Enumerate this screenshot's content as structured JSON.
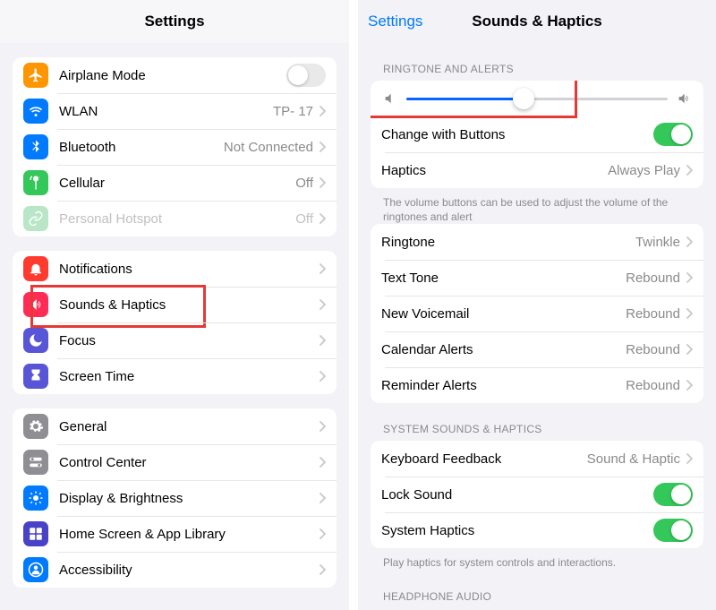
{
  "left": {
    "title": "Settings",
    "groups": [
      {
        "items": [
          {
            "id": "airplane",
            "label": "Airplane Mode",
            "icon": "airplane",
            "color": "#ff9500",
            "control": "toggle",
            "on": false
          },
          {
            "id": "wlan",
            "label": "WLAN",
            "icon": "wifi",
            "color": "#007aff",
            "value": "TP- 17",
            "arrow": true
          },
          {
            "id": "bluetooth",
            "label": "Bluetooth",
            "icon": "bluetooth",
            "color": "#007aff",
            "value": "Not Connected",
            "arrow": true
          },
          {
            "id": "cellular",
            "label": "Cellular",
            "icon": "antenna",
            "color": "#34c759",
            "value": "Off",
            "arrow": true
          },
          {
            "id": "hotspot",
            "label": "Personal Hotspot",
            "icon": "link",
            "color": "#34c759",
            "value": "Off",
            "arrow": true,
            "dimmed": true
          }
        ]
      },
      {
        "items": [
          {
            "id": "notifications",
            "label": "Notifications",
            "icon": "bell",
            "color": "#ff3b30",
            "arrow": true
          },
          {
            "id": "sounds",
            "label": "Sounds & Haptics",
            "icon": "speaker",
            "color": "#ff2d55",
            "arrow": true,
            "highlight": true
          },
          {
            "id": "focus",
            "label": "Focus",
            "icon": "moon",
            "color": "#5856d6",
            "arrow": true
          },
          {
            "id": "screentime",
            "label": "Screen Time",
            "icon": "hourglass",
            "color": "#5856d6",
            "arrow": true
          }
        ]
      },
      {
        "items": [
          {
            "id": "general",
            "label": "General",
            "icon": "gear",
            "color": "#8e8e93",
            "arrow": true
          },
          {
            "id": "controlcenter",
            "label": "Control Center",
            "icon": "switches",
            "color": "#8e8e93",
            "arrow": true
          },
          {
            "id": "display",
            "label": "Display & Brightness",
            "icon": "sun",
            "color": "#007aff",
            "arrow": true
          },
          {
            "id": "home",
            "label": "Home Screen & App Library",
            "icon": "grid",
            "color": "#4842c7",
            "arrow": true
          },
          {
            "id": "accessibility",
            "label": "Accessibility",
            "icon": "person",
            "color": "#007aff",
            "arrow": true
          }
        ]
      }
    ]
  },
  "right": {
    "back_label": "Settings",
    "title": "Sounds & Haptics",
    "sections": [
      {
        "header": "RINGTONE AND ALERTS",
        "slider": {
          "value_pct": 45,
          "highlight": true
        },
        "items": [
          {
            "id": "changebuttons",
            "label": "Change with Buttons",
            "control": "toggle",
            "on": true
          },
          {
            "id": "haptics",
            "label": "Haptics",
            "value": "Always Play",
            "arrow": true
          }
        ],
        "footer": "The volume buttons can be used to adjust the volume of the ringtones and alert"
      },
      {
        "items": [
          {
            "id": "ringtone",
            "label": "Ringtone",
            "value": "Twinkle",
            "arrow": true
          },
          {
            "id": "texttone",
            "label": "Text Tone",
            "value": "Rebound",
            "arrow": true
          },
          {
            "id": "voicemail",
            "label": "New Voicemail",
            "value": "Rebound",
            "arrow": true
          },
          {
            "id": "calendar",
            "label": "Calendar Alerts",
            "value": "Rebound",
            "arrow": true
          },
          {
            "id": "reminder",
            "label": "Reminder Alerts",
            "value": "Rebound",
            "arrow": true
          }
        ]
      },
      {
        "header": "SYSTEM SOUNDS & HAPTICS",
        "items": [
          {
            "id": "keyboard",
            "label": "Keyboard Feedback",
            "value": "Sound & Haptic",
            "arrow": true
          },
          {
            "id": "locksound",
            "label": "Lock Sound",
            "control": "toggle",
            "on": true
          },
          {
            "id": "systemhaptics",
            "label": "System Haptics",
            "control": "toggle",
            "on": true
          }
        ],
        "footer": "Play haptics for system controls and interactions."
      },
      {
        "header": "HEADPHONE AUDIO"
      }
    ]
  }
}
